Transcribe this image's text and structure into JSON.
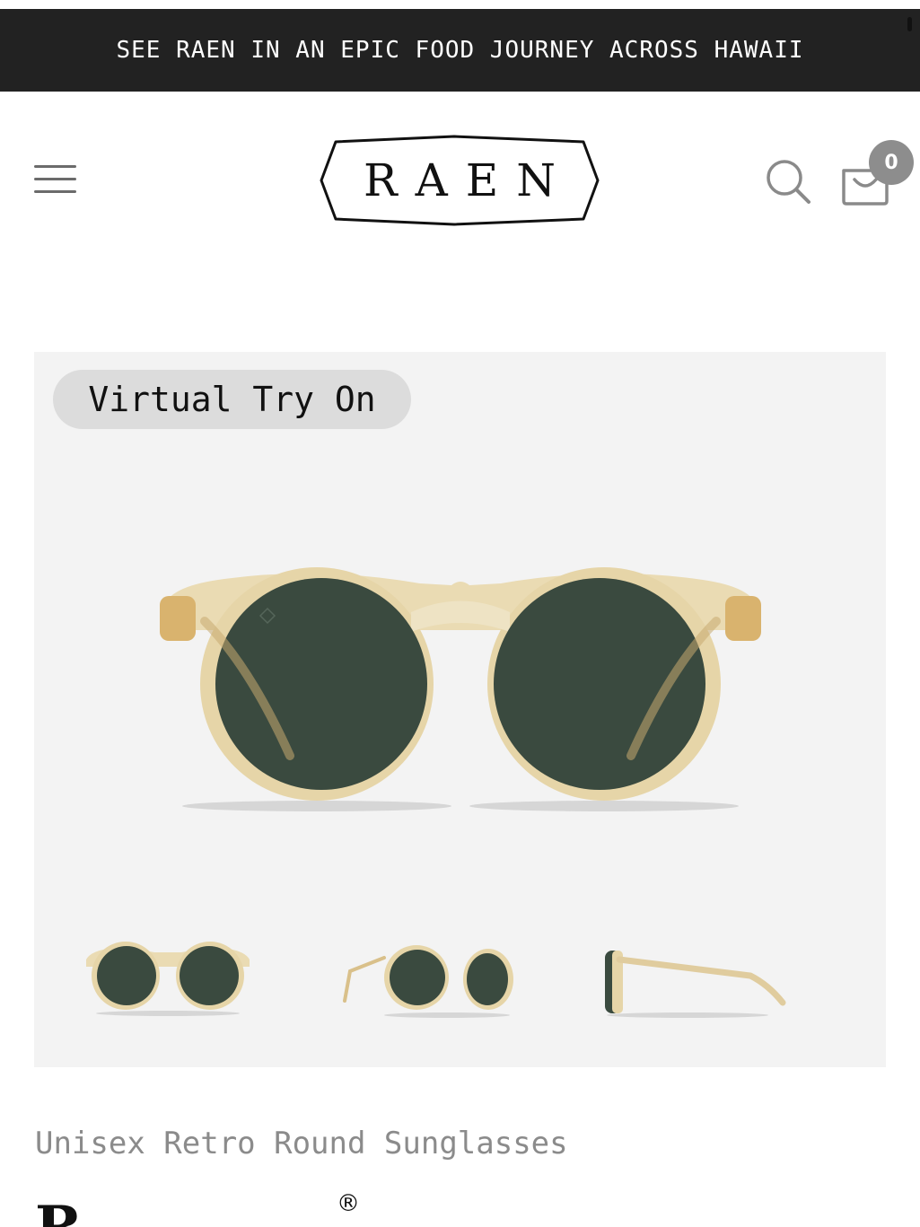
{
  "banner": {
    "text": "SEE RAEN IN AN EPIC FOOD JOURNEY ACROSS HAWAII"
  },
  "header": {
    "logo_text": "RAEN",
    "cart_count": "0"
  },
  "gallery": {
    "try_on_label": "Virtual Try On",
    "thumbnail_count_views": [
      "front",
      "angle",
      "side"
    ]
  },
  "product": {
    "subtitle": "Unisex Retro Round Sunglasses",
    "name_visible": "R",
    "name_mark": "®"
  },
  "colors": {
    "banner_bg": "#222222",
    "gallery_bg": "#f3f3f3",
    "frame_champagne": "#e9d9b0",
    "lens_green": "#3a4a3f",
    "badge_grey": "#8d8d8d",
    "subtitle_grey": "#8b8b8b"
  },
  "icons": {
    "menu": "hamburger-icon",
    "search": "search-icon",
    "cart": "cart-icon"
  }
}
